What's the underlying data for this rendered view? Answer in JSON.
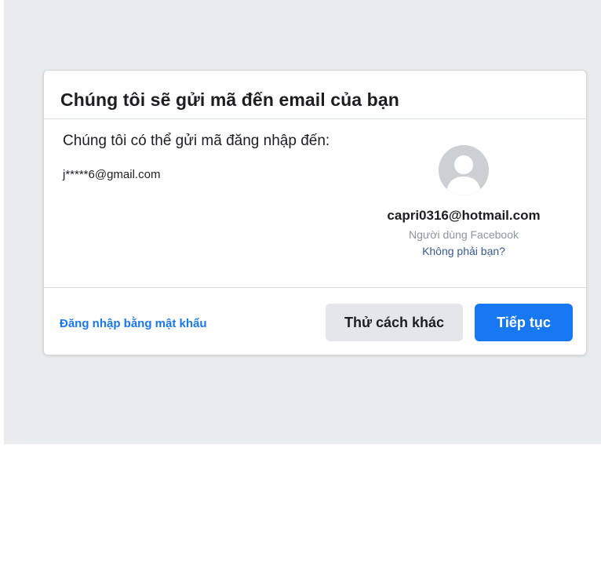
{
  "dialog": {
    "title": "Chúng tôi sẽ gửi mã đến email của bạn",
    "send_description": "Chúng tôi có thể gửi mã đăng nhập đến:",
    "masked_email": "j*****6@gmail.com"
  },
  "profile": {
    "email": "capri0316@hotmail.com",
    "role": "Người dùng Facebook",
    "not_you_link": "Không phải bạn?"
  },
  "footer": {
    "password_login_link": "Đăng nhập bằng mật khẩu",
    "try_another_button": "Thử cách khác",
    "continue_button": "Tiếp tục"
  },
  "colors": {
    "primary": "#1877f2",
    "page_background": "#e9ebee",
    "secondary_button": "#e4e6eb",
    "link_dark": "#385898"
  },
  "icons": {
    "avatar": "default-user-avatar-icon"
  }
}
